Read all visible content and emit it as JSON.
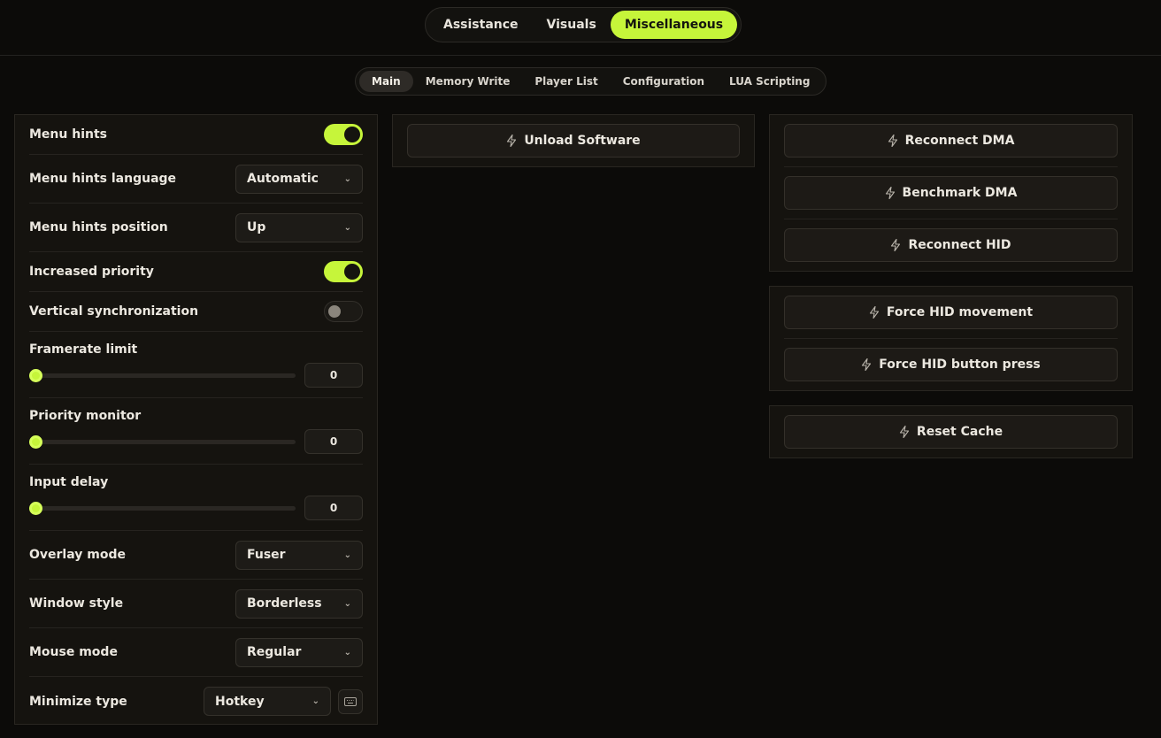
{
  "main_tabs": [
    {
      "label": "Assistance",
      "active": false
    },
    {
      "label": "Visuals",
      "active": false
    },
    {
      "label": "Miscellaneous",
      "active": true
    }
  ],
  "sub_tabs": [
    {
      "label": "Main",
      "active": true
    },
    {
      "label": "Memory Write",
      "active": false
    },
    {
      "label": "Player List",
      "active": false
    },
    {
      "label": "Configuration",
      "active": false
    },
    {
      "label": "LUA Scripting",
      "active": false
    }
  ],
  "settings": {
    "menu_hints": {
      "label": "Menu hints",
      "enabled": true
    },
    "menu_hints_language": {
      "label": "Menu hints language",
      "value": "Automatic"
    },
    "menu_hints_position": {
      "label": "Menu hints position",
      "value": "Up"
    },
    "increased_priority": {
      "label": "Increased priority",
      "enabled": true
    },
    "vertical_sync": {
      "label": "Vertical synchronization",
      "enabled": false
    },
    "framerate_limit": {
      "label": "Framerate limit",
      "value": "0"
    },
    "priority_monitor": {
      "label": "Priority monitor",
      "value": "0"
    },
    "input_delay": {
      "label": "Input delay",
      "value": "0"
    },
    "overlay_mode": {
      "label": "Overlay mode",
      "value": "Fuser"
    },
    "window_style": {
      "label": "Window style",
      "value": "Borderless"
    },
    "mouse_mode": {
      "label": "Mouse mode",
      "value": "Regular"
    },
    "minimize_type": {
      "label": "Minimize type",
      "value": "Hotkey"
    }
  },
  "buttons": {
    "unload": "Unload Software",
    "reconnect_dma": "Reconnect DMA",
    "benchmark_dma": "Benchmark DMA",
    "reconnect_hid": "Reconnect HID",
    "force_hid_movement": "Force HID movement",
    "force_hid_button": "Force HID button press",
    "reset_cache": "Reset Cache"
  },
  "colors": {
    "accent": "#c6f53a",
    "background": "#0c0b09",
    "panel": "#15130f"
  },
  "icons": {
    "button": "lightning-icon",
    "dropdown": "chevron-down-icon",
    "minimize_hotkey": "keyboard-icon"
  }
}
